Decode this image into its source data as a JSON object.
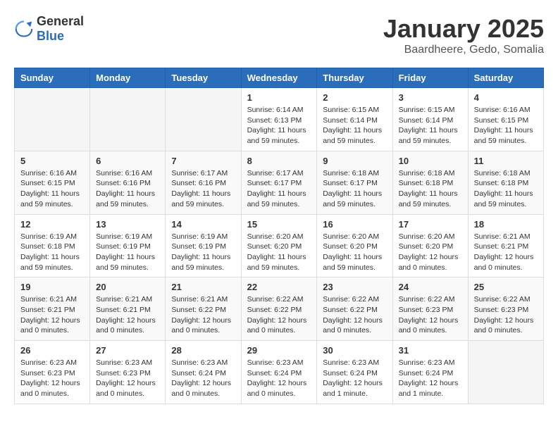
{
  "header": {
    "logo_general": "General",
    "logo_blue": "Blue",
    "month": "January 2025",
    "location": "Baardheere, Gedo, Somalia"
  },
  "days_of_week": [
    "Sunday",
    "Monday",
    "Tuesday",
    "Wednesday",
    "Thursday",
    "Friday",
    "Saturday"
  ],
  "weeks": [
    [
      {
        "day": "",
        "info": ""
      },
      {
        "day": "",
        "info": ""
      },
      {
        "day": "",
        "info": ""
      },
      {
        "day": "1",
        "info": "Sunrise: 6:14 AM\nSunset: 6:13 PM\nDaylight: 11 hours and 59 minutes."
      },
      {
        "day": "2",
        "info": "Sunrise: 6:15 AM\nSunset: 6:14 PM\nDaylight: 11 hours and 59 minutes."
      },
      {
        "day": "3",
        "info": "Sunrise: 6:15 AM\nSunset: 6:14 PM\nDaylight: 11 hours and 59 minutes."
      },
      {
        "day": "4",
        "info": "Sunrise: 6:16 AM\nSunset: 6:15 PM\nDaylight: 11 hours and 59 minutes."
      }
    ],
    [
      {
        "day": "5",
        "info": "Sunrise: 6:16 AM\nSunset: 6:15 PM\nDaylight: 11 hours and 59 minutes."
      },
      {
        "day": "6",
        "info": "Sunrise: 6:16 AM\nSunset: 6:16 PM\nDaylight: 11 hours and 59 minutes."
      },
      {
        "day": "7",
        "info": "Sunrise: 6:17 AM\nSunset: 6:16 PM\nDaylight: 11 hours and 59 minutes."
      },
      {
        "day": "8",
        "info": "Sunrise: 6:17 AM\nSunset: 6:17 PM\nDaylight: 11 hours and 59 minutes."
      },
      {
        "day": "9",
        "info": "Sunrise: 6:18 AM\nSunset: 6:17 PM\nDaylight: 11 hours and 59 minutes."
      },
      {
        "day": "10",
        "info": "Sunrise: 6:18 AM\nSunset: 6:18 PM\nDaylight: 11 hours and 59 minutes."
      },
      {
        "day": "11",
        "info": "Sunrise: 6:18 AM\nSunset: 6:18 PM\nDaylight: 11 hours and 59 minutes."
      }
    ],
    [
      {
        "day": "12",
        "info": "Sunrise: 6:19 AM\nSunset: 6:18 PM\nDaylight: 11 hours and 59 minutes."
      },
      {
        "day": "13",
        "info": "Sunrise: 6:19 AM\nSunset: 6:19 PM\nDaylight: 11 hours and 59 minutes."
      },
      {
        "day": "14",
        "info": "Sunrise: 6:19 AM\nSunset: 6:19 PM\nDaylight: 11 hours and 59 minutes."
      },
      {
        "day": "15",
        "info": "Sunrise: 6:20 AM\nSunset: 6:20 PM\nDaylight: 11 hours and 59 minutes."
      },
      {
        "day": "16",
        "info": "Sunrise: 6:20 AM\nSunset: 6:20 PM\nDaylight: 11 hours and 59 minutes."
      },
      {
        "day": "17",
        "info": "Sunrise: 6:20 AM\nSunset: 6:20 PM\nDaylight: 12 hours and 0 minutes."
      },
      {
        "day": "18",
        "info": "Sunrise: 6:21 AM\nSunset: 6:21 PM\nDaylight: 12 hours and 0 minutes."
      }
    ],
    [
      {
        "day": "19",
        "info": "Sunrise: 6:21 AM\nSunset: 6:21 PM\nDaylight: 12 hours and 0 minutes."
      },
      {
        "day": "20",
        "info": "Sunrise: 6:21 AM\nSunset: 6:21 PM\nDaylight: 12 hours and 0 minutes."
      },
      {
        "day": "21",
        "info": "Sunrise: 6:21 AM\nSunset: 6:22 PM\nDaylight: 12 hours and 0 minutes."
      },
      {
        "day": "22",
        "info": "Sunrise: 6:22 AM\nSunset: 6:22 PM\nDaylight: 12 hours and 0 minutes."
      },
      {
        "day": "23",
        "info": "Sunrise: 6:22 AM\nSunset: 6:22 PM\nDaylight: 12 hours and 0 minutes."
      },
      {
        "day": "24",
        "info": "Sunrise: 6:22 AM\nSunset: 6:23 PM\nDaylight: 12 hours and 0 minutes."
      },
      {
        "day": "25",
        "info": "Sunrise: 6:22 AM\nSunset: 6:23 PM\nDaylight: 12 hours and 0 minutes."
      }
    ],
    [
      {
        "day": "26",
        "info": "Sunrise: 6:23 AM\nSunset: 6:23 PM\nDaylight: 12 hours and 0 minutes."
      },
      {
        "day": "27",
        "info": "Sunrise: 6:23 AM\nSunset: 6:23 PM\nDaylight: 12 hours and 0 minutes."
      },
      {
        "day": "28",
        "info": "Sunrise: 6:23 AM\nSunset: 6:24 PM\nDaylight: 12 hours and 0 minutes."
      },
      {
        "day": "29",
        "info": "Sunrise: 6:23 AM\nSunset: 6:24 PM\nDaylight: 12 hours and 0 minutes."
      },
      {
        "day": "30",
        "info": "Sunrise: 6:23 AM\nSunset: 6:24 PM\nDaylight: 12 hours and 1 minute."
      },
      {
        "day": "31",
        "info": "Sunrise: 6:23 AM\nSunset: 6:24 PM\nDaylight: 12 hours and 1 minute."
      },
      {
        "day": "",
        "info": ""
      }
    ]
  ]
}
